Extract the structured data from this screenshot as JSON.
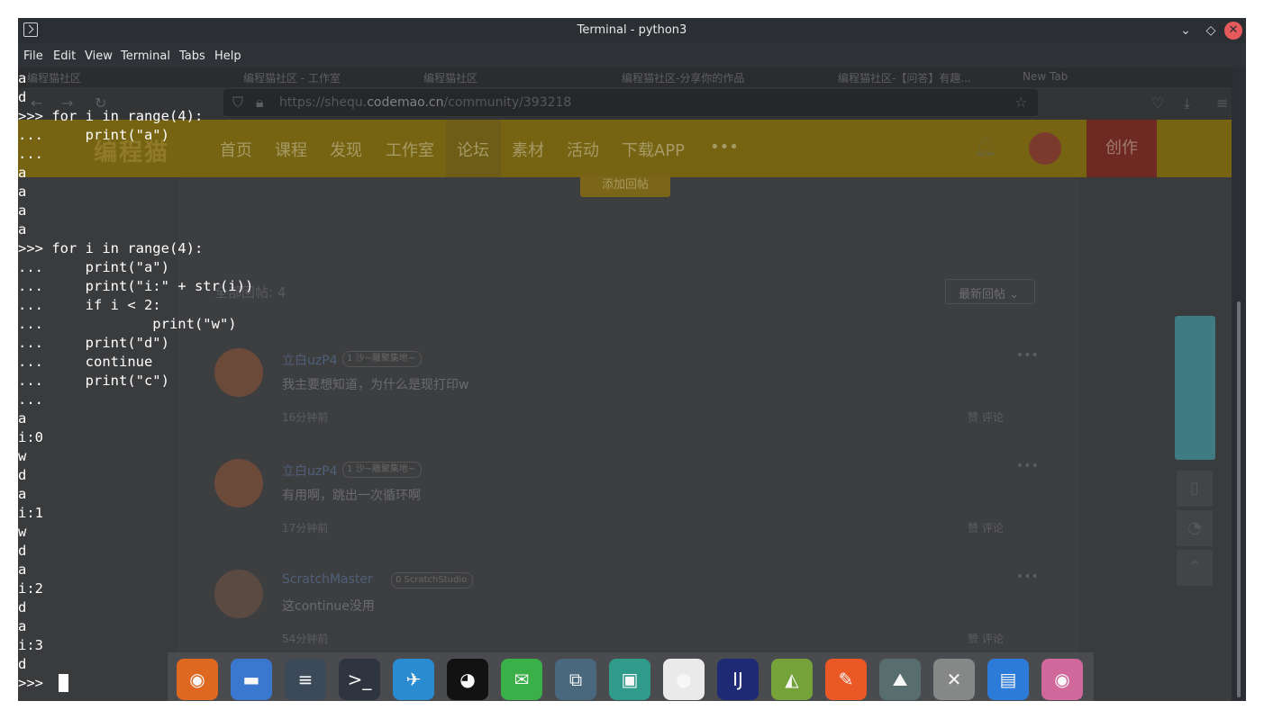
{
  "window": {
    "title": "Terminal - python3",
    "controls": {
      "minimize": "⌄",
      "maximize": "◇",
      "close": "✕"
    }
  },
  "menu": [
    "File",
    "Edit",
    "View",
    "Terminal",
    "Tabs",
    "Help"
  ],
  "terminal_lines": [
    "a",
    "d",
    ">>> for i in range(4):",
    "...     print(\"a\")",
    "...",
    "a",
    "a",
    "a",
    "a",
    ">>> for i in range(4):",
    "...     print(\"a\")",
    "...     print(\"i:\" + str(i))",
    "...     if i < 2:",
    "...             print(\"w\")",
    "...     print(\"d\")",
    "...     continue",
    "...     print(\"c\")",
    "...",
    "a",
    "i:0",
    "w",
    "d",
    "a",
    "i:1",
    "w",
    "d",
    "a",
    "i:2",
    "d",
    "a",
    "i:3",
    "d",
    ">>> "
  ],
  "browser": {
    "url_prefix": "https://shequ.",
    "url_domain": "codemao.cn",
    "url_path": "/community/393218",
    "tab_snippets": [
      "编程猫社区",
      "编程猫社区 - 工作室",
      "编程猫社区",
      "编程猫社区-分享你的作品",
      "编程猫社区-【问答】有趣...",
      "New Tab"
    ],
    "site": {
      "logo": "编程猫",
      "nav": [
        "首页",
        "课程",
        "发现",
        "工作室",
        "论坛",
        "素材",
        "活动",
        "下载APP",
        "•••"
      ],
      "create": "创作",
      "add_reply": "添加回帖",
      "reply_count": "全部回帖: 4",
      "sort": "最新回帖",
      "posts": [
        {
          "user": "立白uzP4",
          "badge": "1 沙~雕聚集地~",
          "message": "我主要想知道，为什么是现打印w",
          "time": "16分钟前",
          "like": "赞",
          "comment": "评论"
        },
        {
          "user": "立白uzP4",
          "badge": "1 沙~雕聚集地~",
          "message": "有用啊，跳出一次循环啊",
          "time": "17分钟前",
          "like": "赞",
          "comment": "评论"
        },
        {
          "user": "ScratchMaster",
          "badge": "0 ScratchStudio",
          "message": "这continue没用",
          "time": "54分钟前",
          "like": "赞",
          "comment": "评论"
        }
      ]
    }
  },
  "dock": [
    "firefox-icon",
    "files-icon",
    "settings-icon",
    "terminal-icon",
    "dingtalk-icon",
    "qq-icon",
    "wechat-icon",
    "screenshot-icon",
    "recorder-icon",
    "beaver-icon",
    "intellij-icon",
    "android-studio-icon",
    "postman-icon",
    "monitor-icon",
    "volume-icon",
    "docs-icon",
    "eye-icon"
  ]
}
